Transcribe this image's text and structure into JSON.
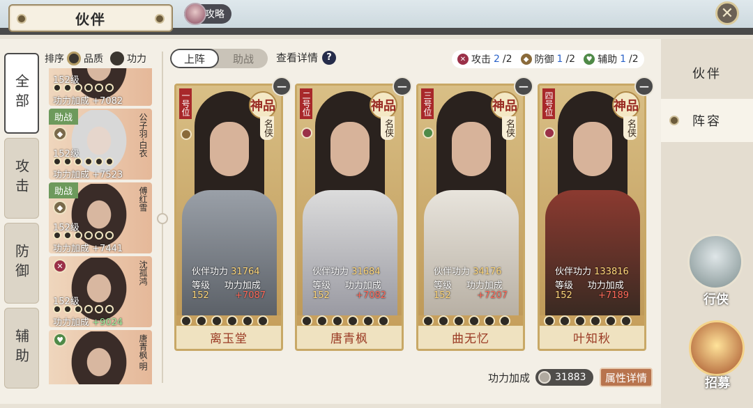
{
  "header": {
    "title": "伙伴",
    "strategy_label": "攻略",
    "close_icon": "close-icon"
  },
  "right_nav": {
    "items": [
      {
        "label": "伙伴"
      },
      {
        "label": "阵容"
      }
    ],
    "travel_label": "行侠",
    "recruit_label": "招募"
  },
  "side_tabs": [
    "全部",
    "攻击",
    "防御",
    "辅助"
  ],
  "sort": {
    "label": "排序",
    "options": [
      "品质",
      "功力"
    ]
  },
  "partner_list": [
    {
      "badge": "",
      "name": "",
      "level": "152级",
      "power_label": "功力加成",
      "bonus": "+7082",
      "bonus_color": "white"
    },
    {
      "badge": "助战",
      "name": "公子羽·白衣",
      "level": "152级",
      "power_label": "功力加成",
      "bonus": "+7523",
      "bonus_color": "white"
    },
    {
      "badge": "助战",
      "name": "傅红雪",
      "level": "152级",
      "power_label": "功力加成",
      "bonus": "+7441",
      "bonus_color": "white"
    },
    {
      "badge": "",
      "name": "沈孤鸿",
      "level": "152级",
      "power_label": "功力加成",
      "bonus": "+9024",
      "bonus_color": "green"
    },
    {
      "badge": "",
      "name": "唐青枫·明",
      "level": "",
      "power_label": "",
      "bonus": "",
      "bonus_color": "white"
    }
  ],
  "lineup_tabs": [
    "上阵",
    "助战"
  ],
  "details_label": "查看详情",
  "slot_summary": [
    {
      "label": "攻击",
      "count": "2",
      "total": "/2",
      "color": "#9a3048"
    },
    {
      "label": "防御",
      "count": "1",
      "total": "/2",
      "color": "#8a6a3a"
    },
    {
      "label": "辅助",
      "count": "1",
      "total": "/2",
      "color": "#4f8a48"
    }
  ],
  "lineup": [
    {
      "position": "一号位",
      "grade": "神品",
      "rank": "名侠",
      "power_label": "伙伴功力",
      "power": "31764",
      "level_label": "等级",
      "level": "152",
      "bonus_label": "功力加成",
      "bonus": "+7087",
      "name": "离玉堂"
    },
    {
      "position": "二号位",
      "grade": "神品",
      "rank": "名侠",
      "power_label": "伙伴功力",
      "power": "31684",
      "level_label": "等级",
      "level": "152",
      "bonus_label": "功力加成",
      "bonus": "+7082",
      "name": "唐青枫"
    },
    {
      "position": "三号位",
      "grade": "神品",
      "rank": "名侠",
      "power_label": "伙伴功力",
      "power": "34176",
      "level_label": "等级",
      "level": "152",
      "bonus_label": "功力加成",
      "bonus": "+7207",
      "name": "曲无忆"
    },
    {
      "position": "四号位",
      "grade": "神品",
      "rank": "名侠",
      "power_label": "伙伴功力",
      "power": "133816",
      "level_label": "等级",
      "level": "152",
      "bonus_label": "功力加成",
      "bonus": "+7189",
      "name": "叶知秋"
    }
  ],
  "footer": {
    "bonus_label": "功力加成",
    "bonus_value": "31883",
    "attr_button": "属性详情"
  }
}
